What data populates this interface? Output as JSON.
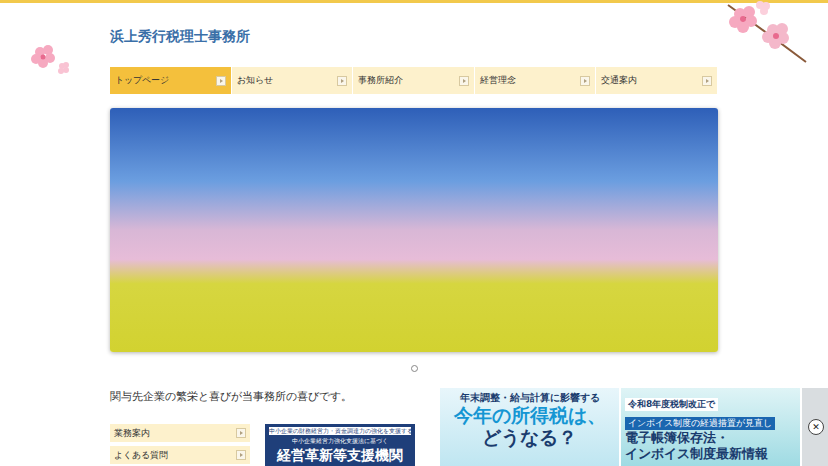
{
  "site": {
    "title": "浜上秀行税理士事務所"
  },
  "nav": [
    {
      "label": "トップページ",
      "selected": true
    },
    {
      "label": "お知らせ",
      "selected": false
    },
    {
      "label": "事務所紹介",
      "selected": false
    },
    {
      "label": "経営理念",
      "selected": false
    },
    {
      "label": "交通案内",
      "selected": false
    }
  ],
  "carousel": {
    "dots": [
      {
        "selected": false
      }
    ]
  },
  "tagline": "関与先企業の繁栄と喜びが当事務所の喜びです。",
  "sidebar": [
    {
      "label": "業務案内"
    },
    {
      "label": "よくある質問"
    }
  ],
  "banner": {
    "lines": [
      "中小企業の財務経営力・資金調達力の強化を支援する",
      "中小企業経営力強化支援法に基づく"
    ],
    "headline": "経営革新等支援機関"
  },
  "ad": {
    "panels": [
      {
        "kicker": "年末調整・給与計算に影響する",
        "headline": [
          "今年の所得税は、",
          "どうなる？"
        ]
      },
      {
        "kicker": "令和8年度税制改正で",
        "subline": "インボイス制度の経過措置が見直し",
        "headline": [
          "電子帳簿保存法・",
          "インボイス制度最新情報"
        ]
      }
    ],
    "close": "✕"
  }
}
